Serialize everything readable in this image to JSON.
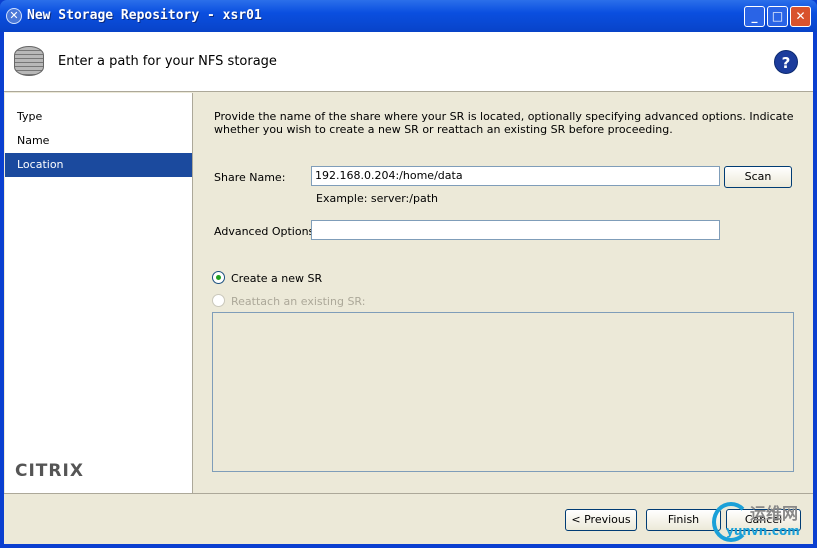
{
  "window": {
    "title": "New Storage Repository - xsr01",
    "minimize": "_",
    "maximize": "□",
    "close": "✕"
  },
  "header": {
    "title": "Enter a path for your NFS storage",
    "help": "?",
    "icon": "storage-disk-icon"
  },
  "sidebar": {
    "steps": [
      {
        "label": "Type",
        "active": false
      },
      {
        "label": "Name",
        "active": false
      },
      {
        "label": "Location",
        "active": true
      }
    ],
    "logo": "CITRIX"
  },
  "content": {
    "description": "Provide the name of the share where your SR is located, optionally specifying advanced options. Indicate whether you wish to create a new SR or reattach an existing SR before proceeding.",
    "share_label": "Share Name:",
    "share_value": "192.168.0.204:/home/data",
    "scan": "Scan",
    "example": "Example: server:/path",
    "advanced_label": "Advanced Options:",
    "advanced_value": "",
    "create_new": "Create a new SR",
    "create_selected": true,
    "reattach": "Reattach an existing SR:",
    "reattach_enabled": false
  },
  "buttons": {
    "previous": "< Previous",
    "finish": "Finish",
    "cancel": "Cancel"
  },
  "watermark": {
    "cn": "运维网",
    "en": "yunvn.com"
  }
}
